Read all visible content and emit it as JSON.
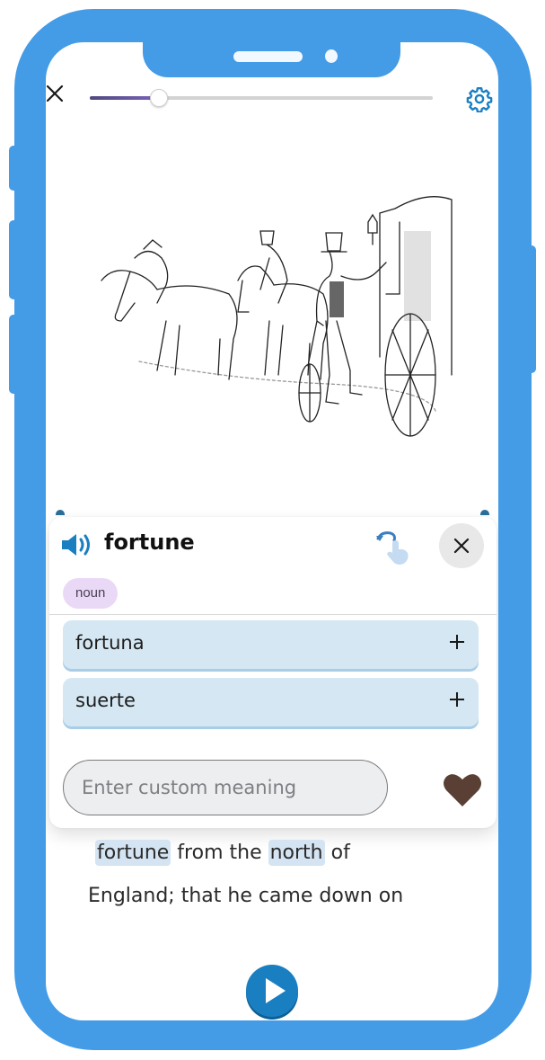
{
  "app": {
    "icons": {
      "close": "close-x-icon",
      "settings": "gear-icon",
      "speaker": "speaker-icon",
      "tap_gesture": "tap-gesture-icon",
      "popover_close": "close-icon",
      "add": "plus-icon",
      "favorite": "heart-icon",
      "play": "play-icon"
    },
    "colors": {
      "frame": "#449be6",
      "accent": "#1a7fc1",
      "progress_fill": "#6a56a6",
      "meaning_bg": "#d5e7f3",
      "badge_bg": "#ead9f6",
      "heart": "#5a4034",
      "highlight": "#d4e4f2"
    }
  },
  "top_bar": {
    "progress_percent": 20
  },
  "illustration": {
    "alt": "Engraving of a gentleman in a top hat opening a carriage door beside horses with riders"
  },
  "popover": {
    "word": "fortune",
    "part_of_speech": "noun",
    "meanings": [
      {
        "label": "fortuna"
      },
      {
        "label": "suerte"
      }
    ],
    "custom_meaning": {
      "value": "",
      "placeholder": "Enter custom meaning"
    }
  },
  "reading": {
    "line1": [
      {
        "text": "fortune",
        "highlight": true
      },
      {
        "text": " from the ",
        "highlight": false
      },
      {
        "text": "north",
        "highlight": true
      },
      {
        "text": " of",
        "highlight": false
      }
    ],
    "line2": "England; that he came down on"
  }
}
